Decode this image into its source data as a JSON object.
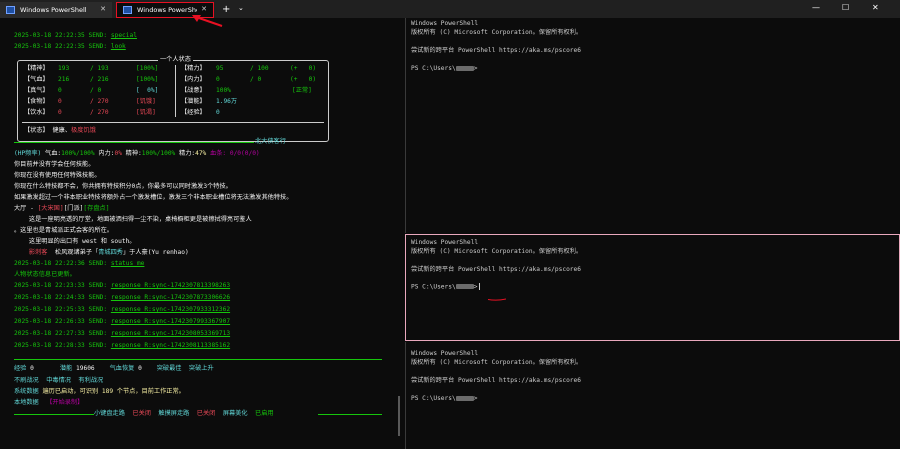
{
  "tabs": [
    {
      "title": "Windows PowerShell",
      "close": "✕"
    },
    {
      "title": "Windows PowerShell",
      "close": "✕"
    }
  ],
  "titlebar": {
    "new_tab": "+",
    "dropdown": "⌄",
    "minimize": "—",
    "maximize": "☐",
    "close": "✕"
  },
  "left": {
    "send1_ts": "2025-03-18 22:22:35 SEND:",
    "send1_cmd": "special",
    "send2_ts": "2025-03-18 22:22:35 SEND:",
    "send2_cmd": "look",
    "status_title": "一个人状态",
    "rows_left": [
      {
        "label": "【精神】",
        "cur": "193",
        "max": "/ 193",
        "pct": "[100%]"
      },
      {
        "label": "【气血】",
        "cur": "216",
        "max": "/ 216",
        "pct": "[100%]"
      },
      {
        "label": "【真气】",
        "cur": "0",
        "max": "/ 0",
        "pct": "[  0%]"
      },
      {
        "label": "【食物】",
        "cur": "0",
        "max": "/ 270",
        "pct": "[饥饿]"
      },
      {
        "label": "【饮水】",
        "cur": "0",
        "max": "/ 270",
        "pct": "[饥渴]"
      }
    ],
    "rows_right": [
      {
        "label": "【精力】",
        "v1": "95",
        "v2": "/ 100",
        "v3": "(+   0)"
      },
      {
        "label": "【内力】",
        "v1": "0",
        "v2": "/ 0",
        "v3": "(+   0)"
      },
      {
        "label": "【战意】",
        "v1": "100%",
        "v2": "",
        "v3": "[正常]"
      },
      {
        "label": "【潜能】",
        "v1": "1.96万",
        "v2": "",
        "v3": ""
      },
      {
        "label": "【经验】",
        "v1": "0",
        "v2": "",
        "v3": ""
      }
    ],
    "state_label": "【状态】",
    "state_normal": "健康、",
    "state_bad": "极度饥饿",
    "banner": "北大侠客行",
    "hp_prefix": "(HP频率)",
    "hp_qixue_label": " 气血:",
    "hp_qixue_val": "100%/100%",
    "hp_neili_label": " 内力:",
    "hp_neili_val": "0%",
    "hp_jingshen_label": " 精神:",
    "hp_jingshen_val": "100%/100%",
    "hp_jingli_label": " 精力:",
    "hp_jingli_val": "47%",
    "hp_xuanshu": " 血条: 0/0(0/0)",
    "msg1": "你目前并没有学会任何技能。",
    "msg2": "你现在没有使用任何特殊技能。",
    "msg3": "你现在什么特技都不会，你共拥有特技积分0点，你最多可以同时激发3个特技。",
    "msg4": "如果激发超过一个非本职业特技将额外占一个激发槽位，激发三个非本职业槽位将无法激发其他特技。",
    "room_prefix": "大厅 - ",
    "room_tag1": "[大宋国]",
    "room_tag2": "[门派]",
    "room_tag3": "[存盘点]",
    "room_desc1": "    这是一座明亮透的厅堂，地面被洒扫得一尘不染，桌椅橱柜更是被擦拭得亮可鉴人",
    "room_desc2": "。这里也是青城派正式会客的所在。",
    "exits": "    这里明显的出口有 west 和 south。",
    "npc_prefix": "    影刺客",
    "npc_mid": "  松风观诸弟子「",
    "npc_name": "青城四秀",
    "npc_rest": "」于人豪(Yu renhao)",
    "send3_ts": "2025-03-18 22:22:36 SEND:",
    "send3_cmd": "status_me",
    "updated": "人物状态信息已更新。",
    "responses": [
      {
        "ts": "2025-03-18 22:23:33 SEND:",
        "cmd": "response R:sync-1742307813398263"
      },
      {
        "ts": "2025-03-18 22:24:33 SEND:",
        "cmd": "response R:sync-1742307873306626"
      },
      {
        "ts": "2025-03-18 22:25:33 SEND:",
        "cmd": "response R:sync-1742307933312362"
      },
      {
        "ts": "2025-03-18 22:26:33 SEND:",
        "cmd": "response R:sync-1742307993367907"
      },
      {
        "ts": "2025-03-18 22:27:33 SEND:",
        "cmd": "response R:sync-1742308053369713"
      },
      {
        "ts": "2025-03-18 22:28:33 SEND:",
        "cmd": "response R:sync-1742308113385162"
      }
    ],
    "footer": {
      "exp_label": "经验",
      "exp_val": "0",
      "pot_label": "潜能",
      "pot_val": "19606",
      "qixue_label": "气血恢复",
      "qixue_val": "0",
      "tupo_label": "突破最佳",
      "shangsheng": "突破上升",
      "stat1": "不刷战况",
      "stat2": "中毒情况",
      "stat3": "有利战况",
      "sys_label": "系统数据",
      "sys_msg": "遍历已启动，可识别 189 个节点，目前工作正常。",
      "local_label": "本地数据",
      "local_val": "【开始录制】",
      "mini1": "小键盘走路",
      "mini1_state": "已关闭",
      "mini2": "触摸屏走路",
      "mini2_state": "已关闭",
      "mini3": "屏幕美化",
      "mini3_state": "已启用"
    }
  },
  "ps": {
    "header": "Windows PowerShell",
    "copyright": "版权所有 (C) Microsoft Corporation。保留所有权利。",
    "tip": "尝试新的跨平台 PowerShell https://aka.ms/pscore6",
    "prompt_pre": "PS C:\\Users\\",
    "prompt_post": ">"
  },
  "colors": {
    "accent_red": "#e81123",
    "pane_border": "#e9a8bd",
    "green": "#16c60c",
    "cyan": "#61d6d6"
  }
}
